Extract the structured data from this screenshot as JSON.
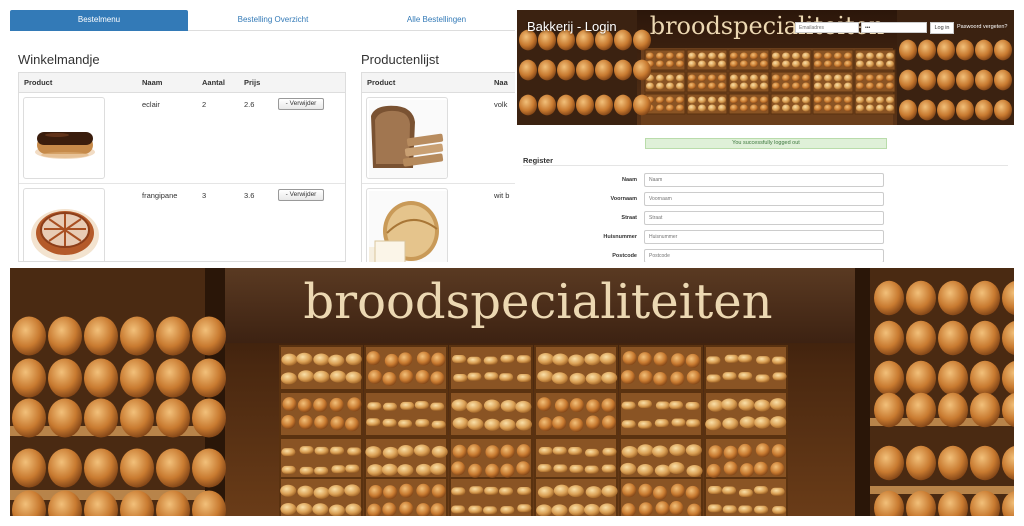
{
  "nav": {
    "tabs": [
      {
        "label": "Bestelmenu"
      },
      {
        "label": "Bestelling Overzicht"
      },
      {
        "label": "Alle Bestellingen"
      }
    ]
  },
  "cart": {
    "title": "Winkelmandje",
    "headers": [
      "Product",
      "Naam",
      "Aantal",
      "Prijs"
    ],
    "rows": [
      {
        "name": "eclair",
        "qty": "2",
        "price": "2.6",
        "action": "- Verwijder",
        "icon": "eclair-image"
      },
      {
        "name": "frangipane",
        "qty": "3",
        "price": "3.6",
        "action": "- Verwijder",
        "icon": "frangipane-image"
      }
    ]
  },
  "products": {
    "title": "Productenlijst",
    "headers": [
      "Product",
      "Naa"
    ],
    "rows": [
      {
        "name": "volk",
        "icon": "volkoren-brood-image"
      },
      {
        "name": "wit b",
        "icon": "wit-brood-image"
      }
    ]
  },
  "login": {
    "brand": "Bakkerij - Login",
    "sign_text": "broodspecialiteiten",
    "email_placeholder": "Emailadres",
    "password_value": "•••",
    "login_button": "Log in",
    "forgot_link": "Paswoord vergeten?",
    "alert": "You successfully logged out"
  },
  "register": {
    "title": "Register",
    "fields": [
      {
        "label": "Naam",
        "placeholder": "Naam"
      },
      {
        "label": "Voornaam",
        "placeholder": "Voornaam"
      },
      {
        "label": "Straat",
        "placeholder": "Straat"
      },
      {
        "label": "Huisnummer",
        "placeholder": "Huisnummer"
      },
      {
        "label": "Postcode",
        "placeholder": "Postcode"
      }
    ]
  },
  "hero": {
    "sign_text": "broodspecialiteiten"
  },
  "colors": {
    "primary": "#337ab7",
    "alert_bg": "#dff0d8",
    "alert_text": "#3c763d",
    "wood_dark": "#3a200e",
    "bread": "#c47a32"
  }
}
